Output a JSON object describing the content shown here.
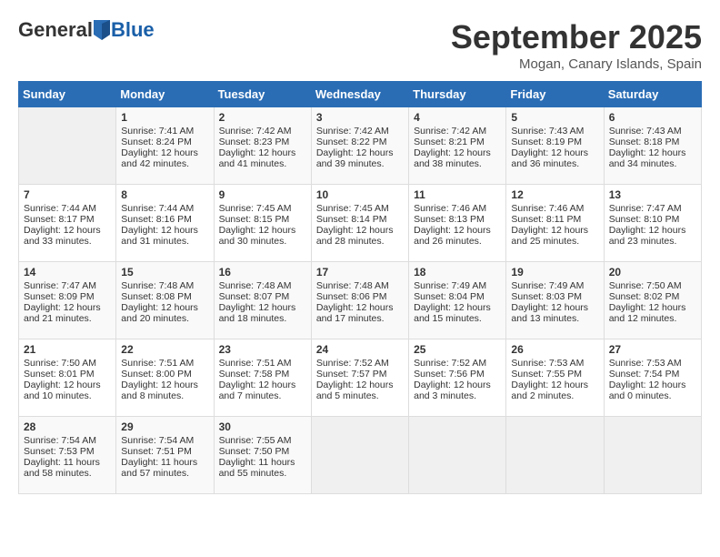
{
  "header": {
    "logo_general": "General",
    "logo_blue": "Blue",
    "month_title": "September 2025",
    "location": "Mogan, Canary Islands, Spain"
  },
  "days_of_week": [
    "Sunday",
    "Monday",
    "Tuesday",
    "Wednesday",
    "Thursday",
    "Friday",
    "Saturday"
  ],
  "weeks": [
    [
      {
        "day": null,
        "content": null
      },
      {
        "day": "1",
        "content": "Sunrise: 7:41 AM\nSunset: 8:24 PM\nDaylight: 12 hours and 42 minutes."
      },
      {
        "day": "2",
        "content": "Sunrise: 7:42 AM\nSunset: 8:23 PM\nDaylight: 12 hours and 41 minutes."
      },
      {
        "day": "3",
        "content": "Sunrise: 7:42 AM\nSunset: 8:22 PM\nDaylight: 12 hours and 39 minutes."
      },
      {
        "day": "4",
        "content": "Sunrise: 7:42 AM\nSunset: 8:21 PM\nDaylight: 12 hours and 38 minutes."
      },
      {
        "day": "5",
        "content": "Sunrise: 7:43 AM\nSunset: 8:19 PM\nDaylight: 12 hours and 36 minutes."
      },
      {
        "day": "6",
        "content": "Sunrise: 7:43 AM\nSunset: 8:18 PM\nDaylight: 12 hours and 34 minutes."
      }
    ],
    [
      {
        "day": "7",
        "content": "Sunrise: 7:44 AM\nSunset: 8:17 PM\nDaylight: 12 hours and 33 minutes."
      },
      {
        "day": "8",
        "content": "Sunrise: 7:44 AM\nSunset: 8:16 PM\nDaylight: 12 hours and 31 minutes."
      },
      {
        "day": "9",
        "content": "Sunrise: 7:45 AM\nSunset: 8:15 PM\nDaylight: 12 hours and 30 minutes."
      },
      {
        "day": "10",
        "content": "Sunrise: 7:45 AM\nSunset: 8:14 PM\nDaylight: 12 hours and 28 minutes."
      },
      {
        "day": "11",
        "content": "Sunrise: 7:46 AM\nSunset: 8:13 PM\nDaylight: 12 hours and 26 minutes."
      },
      {
        "day": "12",
        "content": "Sunrise: 7:46 AM\nSunset: 8:11 PM\nDaylight: 12 hours and 25 minutes."
      },
      {
        "day": "13",
        "content": "Sunrise: 7:47 AM\nSunset: 8:10 PM\nDaylight: 12 hours and 23 minutes."
      }
    ],
    [
      {
        "day": "14",
        "content": "Sunrise: 7:47 AM\nSunset: 8:09 PM\nDaylight: 12 hours and 21 minutes."
      },
      {
        "day": "15",
        "content": "Sunrise: 7:48 AM\nSunset: 8:08 PM\nDaylight: 12 hours and 20 minutes."
      },
      {
        "day": "16",
        "content": "Sunrise: 7:48 AM\nSunset: 8:07 PM\nDaylight: 12 hours and 18 minutes."
      },
      {
        "day": "17",
        "content": "Sunrise: 7:48 AM\nSunset: 8:06 PM\nDaylight: 12 hours and 17 minutes."
      },
      {
        "day": "18",
        "content": "Sunrise: 7:49 AM\nSunset: 8:04 PM\nDaylight: 12 hours and 15 minutes."
      },
      {
        "day": "19",
        "content": "Sunrise: 7:49 AM\nSunset: 8:03 PM\nDaylight: 12 hours and 13 minutes."
      },
      {
        "day": "20",
        "content": "Sunrise: 7:50 AM\nSunset: 8:02 PM\nDaylight: 12 hours and 12 minutes."
      }
    ],
    [
      {
        "day": "21",
        "content": "Sunrise: 7:50 AM\nSunset: 8:01 PM\nDaylight: 12 hours and 10 minutes."
      },
      {
        "day": "22",
        "content": "Sunrise: 7:51 AM\nSunset: 8:00 PM\nDaylight: 12 hours and 8 minutes."
      },
      {
        "day": "23",
        "content": "Sunrise: 7:51 AM\nSunset: 7:58 PM\nDaylight: 12 hours and 7 minutes."
      },
      {
        "day": "24",
        "content": "Sunrise: 7:52 AM\nSunset: 7:57 PM\nDaylight: 12 hours and 5 minutes."
      },
      {
        "day": "25",
        "content": "Sunrise: 7:52 AM\nSunset: 7:56 PM\nDaylight: 12 hours and 3 minutes."
      },
      {
        "day": "26",
        "content": "Sunrise: 7:53 AM\nSunset: 7:55 PM\nDaylight: 12 hours and 2 minutes."
      },
      {
        "day": "27",
        "content": "Sunrise: 7:53 AM\nSunset: 7:54 PM\nDaylight: 12 hours and 0 minutes."
      }
    ],
    [
      {
        "day": "28",
        "content": "Sunrise: 7:54 AM\nSunset: 7:53 PM\nDaylight: 11 hours and 58 minutes."
      },
      {
        "day": "29",
        "content": "Sunrise: 7:54 AM\nSunset: 7:51 PM\nDaylight: 11 hours and 57 minutes."
      },
      {
        "day": "30",
        "content": "Sunrise: 7:55 AM\nSunset: 7:50 PM\nDaylight: 11 hours and 55 minutes."
      },
      {
        "day": null,
        "content": null
      },
      {
        "day": null,
        "content": null
      },
      {
        "day": null,
        "content": null
      },
      {
        "day": null,
        "content": null
      }
    ]
  ]
}
